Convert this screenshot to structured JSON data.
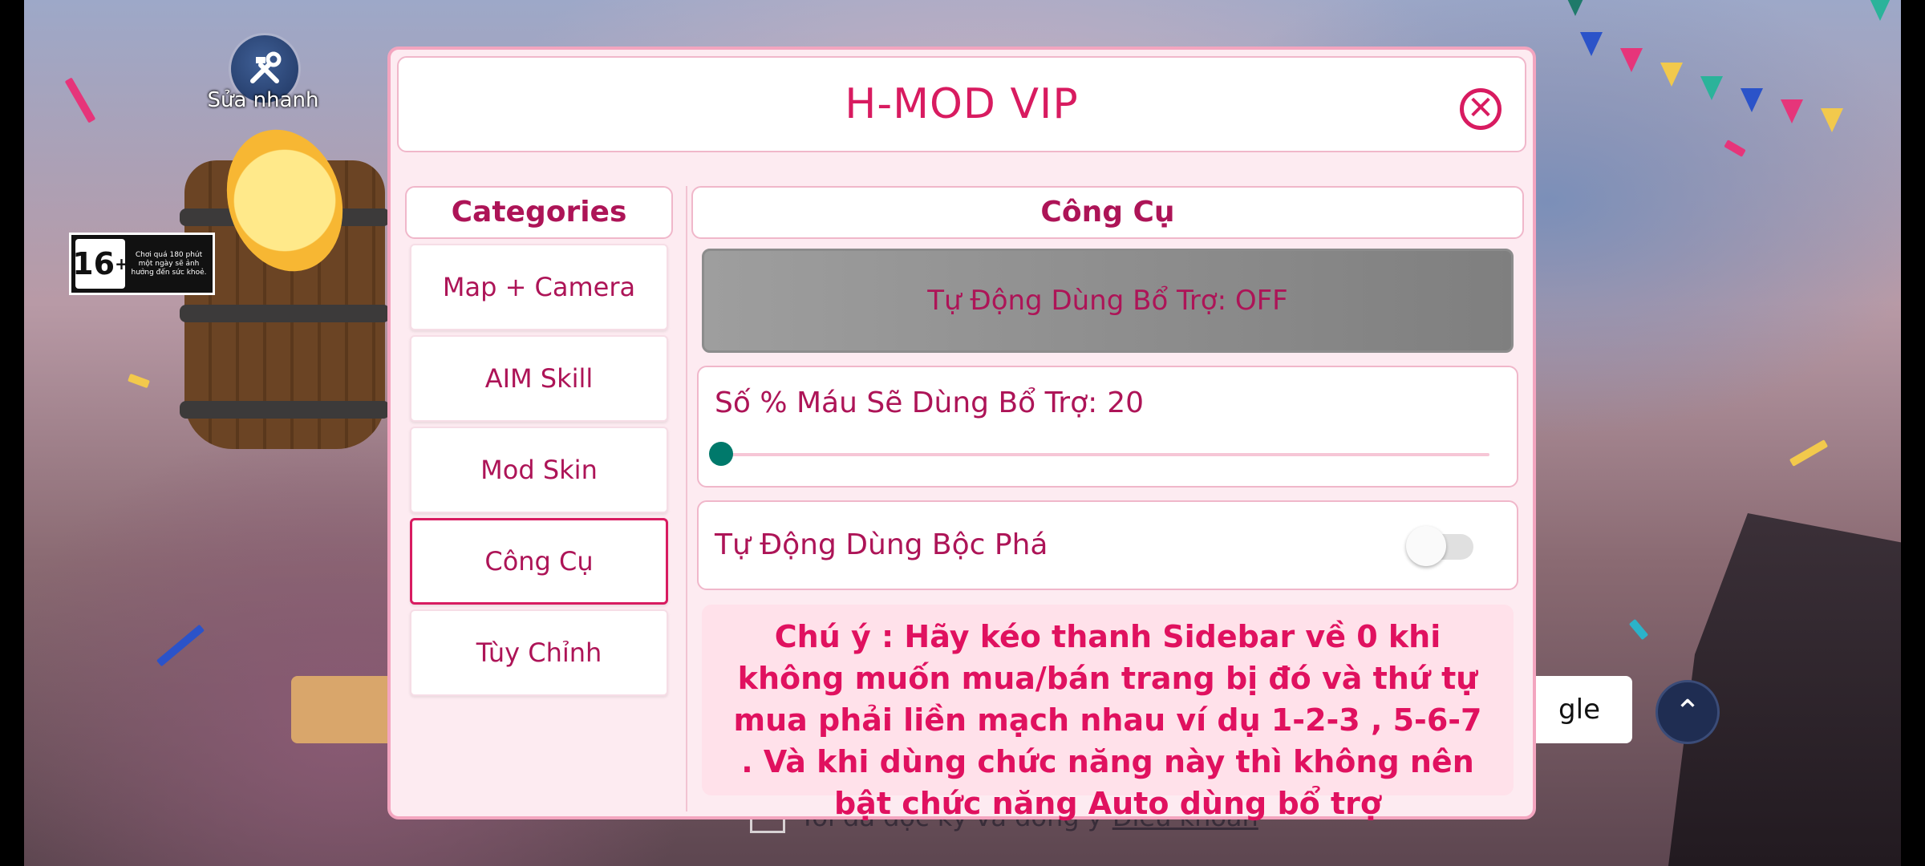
{
  "background": {
    "repair_button_label": "Sửa nhanh",
    "age_rating": "16",
    "age_plus": "+",
    "age_note": "Chơi quá 180 phút một ngày sẽ ảnh hưởng đến sức khoẻ.",
    "login_right_text": "gle",
    "terms_text": "Tôi đã đọc kỹ và đồng ý",
    "terms_link": "Điều khoản"
  },
  "modal": {
    "title": "H-MOD VIP",
    "close_icon": "close-circle-icon",
    "accent_color": "#d81b60"
  },
  "sidebar": {
    "title": "Categories",
    "items": [
      {
        "label": "Map + Camera",
        "active": false
      },
      {
        "label": "AIM Skill",
        "active": false
      },
      {
        "label": "Mod Skin",
        "active": false
      },
      {
        "label": "Công Cụ",
        "active": true
      },
      {
        "label": "Tùy Chỉnh",
        "active": false
      }
    ]
  },
  "content": {
    "title": "Công Cụ",
    "auto_support_button": "Tự Động Dùng Bổ Trợ: OFF",
    "hp_slider": {
      "label": "Số % Máu Sẽ Dùng Bổ Trợ:",
      "value": "20",
      "fill_fraction": 0
    },
    "burst_toggle": {
      "label": "Tự Động Dùng Bộc Phá",
      "on": false
    },
    "note": "Chú ý : Hãy kéo thanh Sidebar về 0 khi không muốn mua/bán trang bị đó và thứ tự mua phải liền mạch nhau ví dụ 1-2-3 , 5-6-7 . Và khi dùng chức năng này thì không nên bật chức năng Auto dùng bổ trợ"
  }
}
